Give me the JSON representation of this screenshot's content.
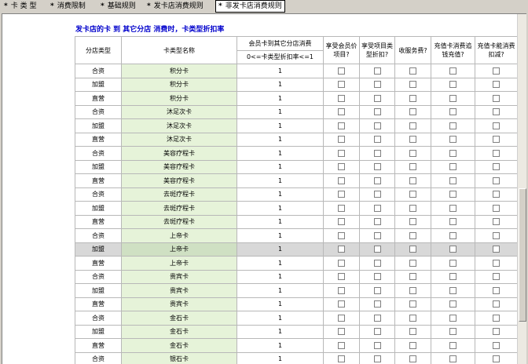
{
  "tabs": [
    {
      "label": "卡 类 型",
      "active": false
    },
    {
      "label": "消费限制",
      "active": false
    },
    {
      "label": "基础规则",
      "active": false
    },
    {
      "label": "发卡店消费规则",
      "active": false
    },
    {
      "label": "非发卡店消费规则",
      "active": true
    }
  ],
  "caption": "发卡店的卡 到 其它分店 消费时，卡类型折扣率",
  "headers": {
    "store_type": "分店类型",
    "card_name": "卡类型名称",
    "discount_top": "会员卡到其它分店消费",
    "discount_bottom": "0<=卡类型折扣率<=1",
    "member_price": "享受会员价项目?",
    "item_discount": "享受项目类型折扣?",
    "service_fee": "收服务费?",
    "recharge_track": "充值卡消费追钱充值?",
    "recharge_deduct": "充值卡能消费扣减?"
  },
  "rows": [
    {
      "store_type": "合资",
      "card_name": "积分卡",
      "rate": "1"
    },
    {
      "store_type": "加盟",
      "card_name": "积分卡",
      "rate": "1"
    },
    {
      "store_type": "直营",
      "card_name": "积分卡",
      "rate": "1"
    },
    {
      "store_type": "合资",
      "card_name": "沐足次卡",
      "rate": "1"
    },
    {
      "store_type": "加盟",
      "card_name": "沐足次卡",
      "rate": "1"
    },
    {
      "store_type": "直营",
      "card_name": "沐足次卡",
      "rate": "1"
    },
    {
      "store_type": "合资",
      "card_name": "美容疗程卡",
      "rate": "1"
    },
    {
      "store_type": "加盟",
      "card_name": "美容疗程卡",
      "rate": "1"
    },
    {
      "store_type": "直营",
      "card_name": "美容疗程卡",
      "rate": "1"
    },
    {
      "store_type": "合资",
      "card_name": "去斑疗程卡",
      "rate": "1"
    },
    {
      "store_type": "加盟",
      "card_name": "去斑疗程卡",
      "rate": "1"
    },
    {
      "store_type": "直营",
      "card_name": "去斑疗程卡",
      "rate": "1"
    },
    {
      "store_type": "合资",
      "card_name": "上帝卡",
      "rate": "1"
    },
    {
      "store_type": "加盟",
      "card_name": "上帝卡",
      "rate": "1",
      "selected": true
    },
    {
      "store_type": "直营",
      "card_name": "上帝卡",
      "rate": "1"
    },
    {
      "store_type": "合资",
      "card_name": "贵宾卡",
      "rate": "1"
    },
    {
      "store_type": "加盟",
      "card_name": "贵宾卡",
      "rate": "1"
    },
    {
      "store_type": "直营",
      "card_name": "贵宾卡",
      "rate": "1"
    },
    {
      "store_type": "合资",
      "card_name": "金石卡",
      "rate": "1"
    },
    {
      "store_type": "加盟",
      "card_name": "金石卡",
      "rate": "1"
    },
    {
      "store_type": "直营",
      "card_name": "金石卡",
      "rate": "1"
    },
    {
      "store_type": "合资",
      "card_name": "银石卡",
      "rate": "1"
    }
  ]
}
